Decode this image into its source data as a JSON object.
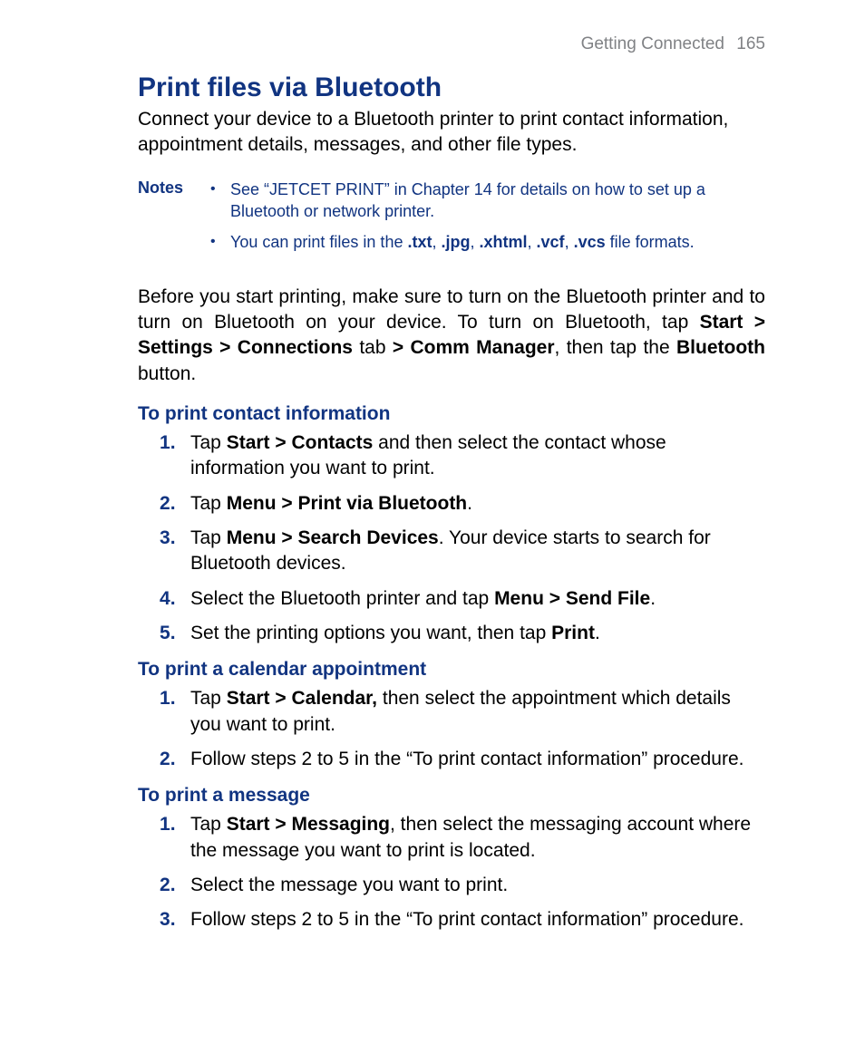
{
  "header": {
    "chapter": "Getting Connected",
    "page": "165"
  },
  "title": "Print files via Bluetooth",
  "lead": "Connect your device to a Bluetooth printer to print contact information, appointment details, messages, and other file types.",
  "notes": {
    "label": "Notes",
    "items": [
      {
        "html": "See “JETCET PRINT” in Chapter 14 for details on how to set up a Bluetooth or network printer."
      },
      {
        "html": "You can print files in the <b>.txt</b>, <b>.jpg</b>, <b>.xhtml</b>, <b>.vcf</b>, <b>.vcs</b> file formats."
      }
    ]
  },
  "pre_body_html": "Before you start printing, make sure to turn on the Bluetooth printer and to turn on Bluetooth on your device. To turn on Bluetooth, tap <b>Start > Settings > Connections</b> tab <b>> Comm Manager</b>, then tap the <b>Bluetooth</b> button.",
  "sections": [
    {
      "heading": "To print contact information",
      "steps": [
        "Tap <b>Start > Contacts</b> and then select the contact whose information you want to print.",
        "Tap <b>Menu > Print via Bluetooth</b>.",
        "Tap <b>Menu > Search Devices</b>. Your device starts to search for Bluetooth devices.",
        "Select the Bluetooth printer and tap <b>Menu > Send File</b>.",
        "Set the printing options you want, then tap <b>Print</b>."
      ]
    },
    {
      "heading": "To print a calendar appointment",
      "steps": [
        "Tap <b>Start > Calendar,</b> then select the appointment which details you want to print.",
        "Follow steps 2 to 5 in the “To print contact information” procedure."
      ]
    },
    {
      "heading": "To print a message",
      "steps": [
        "Tap <b>Start > Messaging</b>, then select the messaging account where the message you want to print is located.",
        "Select the message you want to print.",
        "Follow steps 2 to 5 in the “To print contact information” procedure."
      ]
    }
  ]
}
